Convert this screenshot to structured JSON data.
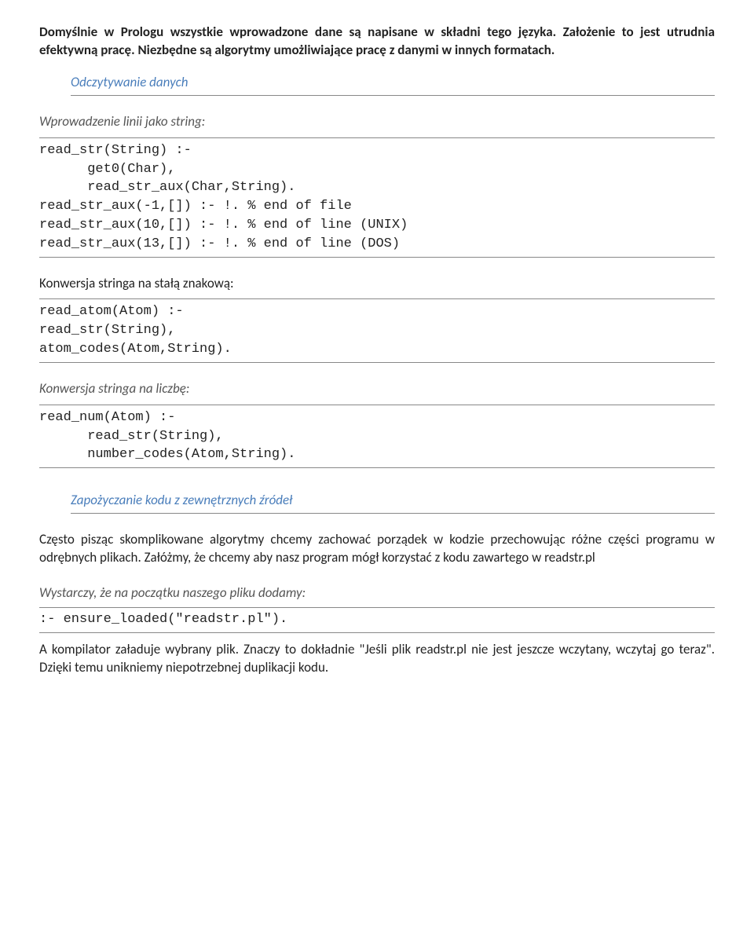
{
  "intro": {
    "p1": "Domyślnie w Prologu wszystkie wprowadzone dane są napisane w składni tego języka. Założenie to jest utrudnia efektywną pracę. Niezbędne są algorytmy umożliwiające pracę z danymi w innych formatach."
  },
  "section1": {
    "heading": "Odczytywanie danych",
    "sub1": "Wprowadzenie linii jako string:",
    "code1": "read_str(String) :-\n      get0(Char),\n      read_str_aux(Char,String).\nread_str_aux(-1,[]) :- !. % end of file\nread_str_aux(10,[]) :- !. % end of line (UNIX)\nread_str_aux(13,[]) :- !. % end of line (DOS)",
    "sub2": "Konwersja stringa na stałą znakową:",
    "code2": "read_atom(Atom) :-\nread_str(String),\natom_codes(Atom,String).",
    "sub3": "Konwersja stringa na liczbę:",
    "code3": "read_num(Atom) :-\n      read_str(String),\n      number_codes(Atom,String)."
  },
  "section2": {
    "heading": "Zapożyczanie kodu z zewnętrznych źródeł",
    "p1": "Często pisząc skomplikowane algorytmy chcemy zachować porządek w kodzie przechowując różne części programu w odrębnych plikach. Załóżmy, że chcemy aby nasz program mógł korzystać z kodu zawartego w readstr.pl",
    "sub1": "Wystarczy, że na początku naszego pliku dodamy:",
    "code1": ":- ensure_loaded(\"readstr.pl\").",
    "p2": "A kompilator załaduje wybrany plik. Znaczy to dokładnie \"Jeśli plik readstr.pl nie jest jeszcze wczytany, wczytaj go teraz\". Dzięki temu unikniemy niepotrzebnej duplikacji kodu."
  }
}
